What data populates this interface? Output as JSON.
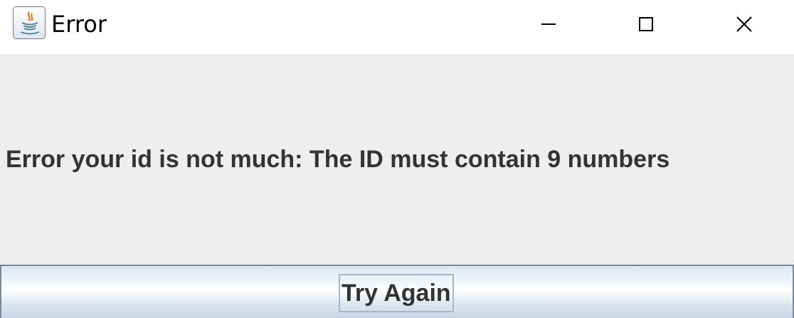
{
  "window": {
    "title": "Error",
    "app_icon": "java-coffee-cup-icon",
    "controls": {
      "minimize_icon": "minimize-icon",
      "maximize_icon": "maximize-icon",
      "close_icon": "close-icon"
    }
  },
  "dialog": {
    "message": "Error  your id is not much: The ID must contain 9 numbers",
    "button_label": "Try Again"
  },
  "colors": {
    "titlebar": "#ffffff",
    "content_bg": "#eeeeee",
    "text": "#333333"
  }
}
